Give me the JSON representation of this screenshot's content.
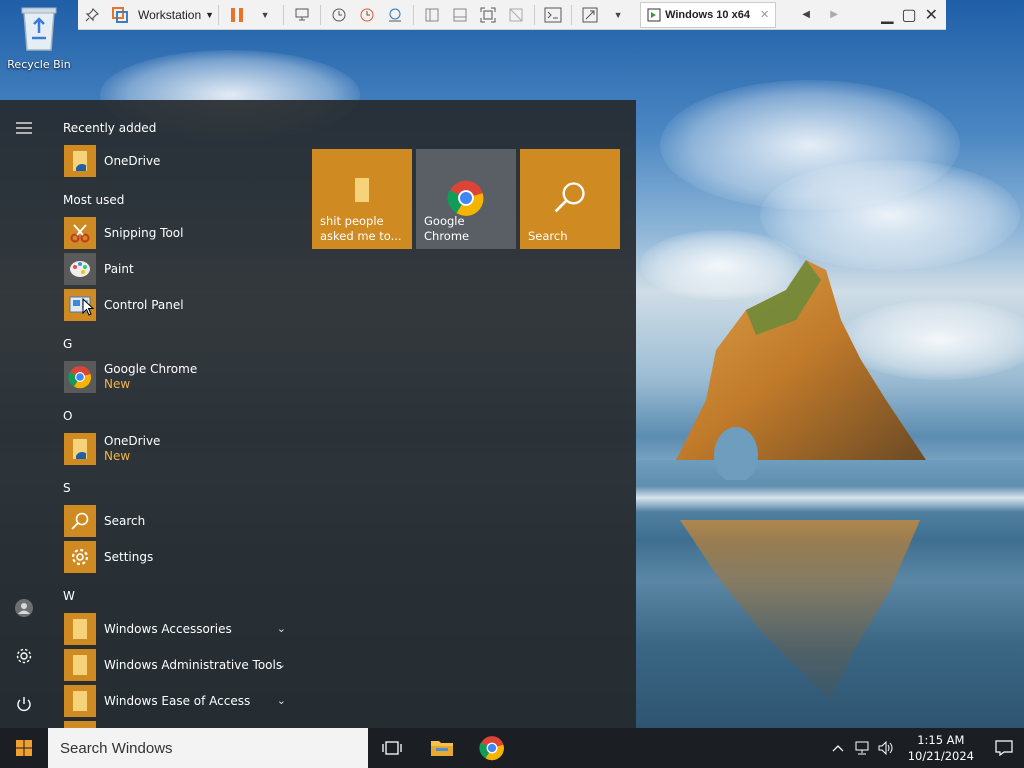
{
  "desktop": {
    "recycle_bin_label": "Recycle Bin"
  },
  "vm_toolbar": {
    "workstation_label": "Workstation",
    "tab_label": "Windows 10 x64",
    "pause_color": "#e8742a"
  },
  "start_menu": {
    "accent": "#d08a22",
    "recently_added_header": "Recently added",
    "recently_added": [
      {
        "label": "OneDrive",
        "icon": "folder-onedrive-icon"
      }
    ],
    "most_used_header": "Most used",
    "most_used": [
      {
        "label": "Snipping Tool",
        "icon": "scissors-icon"
      },
      {
        "label": "Paint",
        "icon": "paint-palette-icon"
      },
      {
        "label": "Control Panel",
        "icon": "control-panel-icon"
      }
    ],
    "groups": [
      {
        "letter": "G",
        "items": [
          {
            "label": "Google Chrome",
            "sub": "New",
            "icon": "chrome-icon"
          }
        ]
      },
      {
        "letter": "O",
        "items": [
          {
            "label": "OneDrive",
            "sub": "New",
            "icon": "folder-onedrive-icon"
          }
        ]
      },
      {
        "letter": "S",
        "items": [
          {
            "label": "Search",
            "icon": "search-icon"
          },
          {
            "label": "Settings",
            "icon": "gear-icon"
          }
        ]
      },
      {
        "letter": "W",
        "items": [
          {
            "label": "Windows Accessories",
            "icon": "folder-icon"
          },
          {
            "label": "Windows Administrative Tools",
            "icon": "folder-icon"
          },
          {
            "label": "Windows Ease of Access",
            "icon": "folder-icon"
          }
        ]
      }
    ],
    "tiles": [
      {
        "label": "shit people asked me to...",
        "icon": "folder-icon"
      },
      {
        "label": "Google Chrome",
        "icon": "chrome-icon"
      },
      {
        "label": "Search",
        "icon": "search-icon"
      }
    ]
  },
  "taskbar": {
    "search_placeholder": "Search Windows",
    "time": "1:15 AM",
    "date": "10/21/2024"
  }
}
